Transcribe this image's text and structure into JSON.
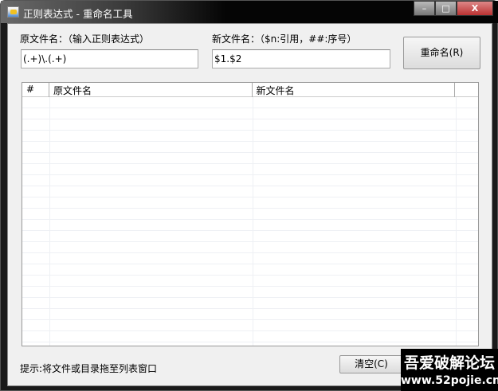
{
  "window": {
    "title": "正则表达式 - 重命名工具",
    "minimize": "–",
    "maximize": "□",
    "close": "X"
  },
  "form": {
    "source_label": "原文件名：（输入正则表达式）",
    "source_value": "(.+)\\.(.+)",
    "target_label": "新文件名：（$n:引用，##:序号）",
    "target_value": "$1.$2",
    "rename_button": "重命名(R)"
  },
  "list": {
    "columns": [
      "#",
      "原文件名",
      "新文件名",
      ""
    ],
    "rows": []
  },
  "footer": {
    "hint": "提示:将文件或目录拖至列表窗口",
    "clear_button": "清空(C)"
  },
  "watermark": {
    "name": "吾爱破解论坛",
    "url": "www.52pojie.cn"
  }
}
